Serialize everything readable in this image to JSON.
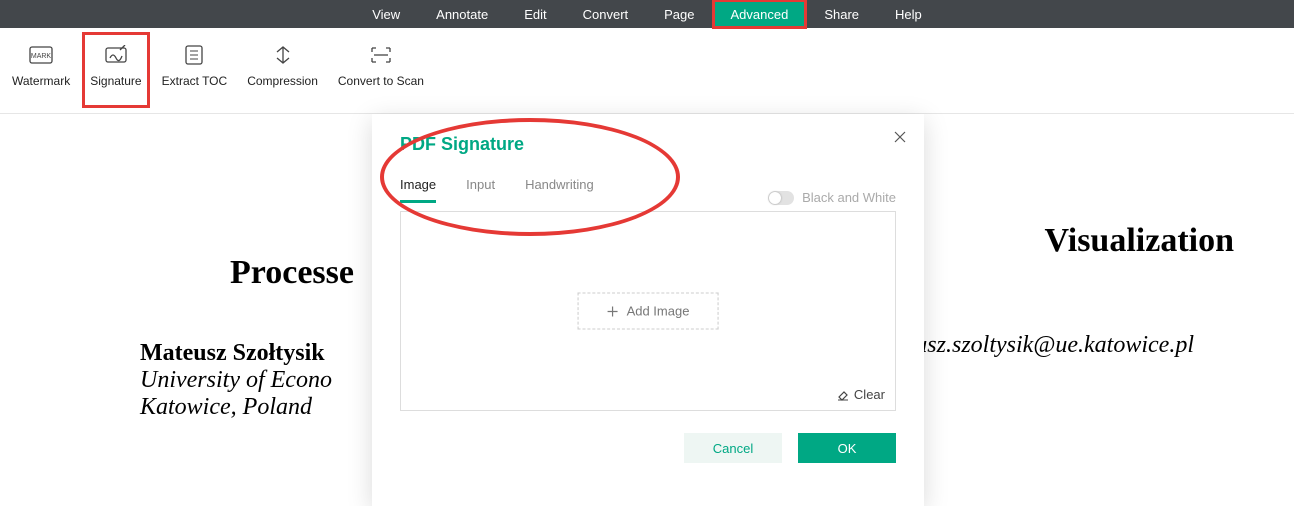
{
  "menubar": {
    "items": [
      "View",
      "Annotate",
      "Edit",
      "Convert",
      "Page",
      "Advanced",
      "Share",
      "Help"
    ],
    "active_index": 5,
    "highlight_index": 5
  },
  "ribbon": {
    "buttons": [
      {
        "label": "Watermark"
      },
      {
        "label": "Signature",
        "highlight": true
      },
      {
        "label": "Extract TOC"
      },
      {
        "label": "Compression"
      },
      {
        "label": "Convert to Scan"
      }
    ]
  },
  "document": {
    "title_left": "Processe",
    "title_right": "Visualization",
    "author_name": "Mateusz Szołtysik",
    "affiliation_line1": "University of Econo",
    "affiliation_line2": "Katowice, Poland",
    "email_fragment": "eusz.szoltysik@ue.katowice.pl"
  },
  "dialog": {
    "title": "PDF Signature",
    "tabs": [
      "Image",
      "Input",
      "Handwriting"
    ],
    "active_tab_index": 0,
    "bw_label": "Black and White",
    "add_image_label": "Add Image",
    "clear_label": "Clear",
    "cancel_label": "Cancel",
    "ok_label": "OK"
  }
}
